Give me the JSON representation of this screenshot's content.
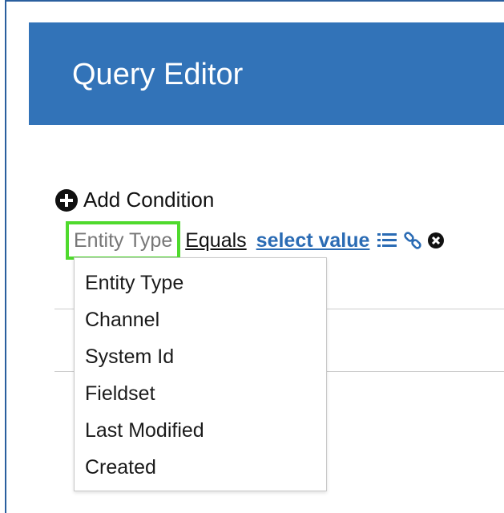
{
  "header": {
    "title": "Query Editor",
    "background_color": "#3273b8"
  },
  "add_condition": {
    "icon": "plus-circle-icon",
    "label": "Add Condition"
  },
  "condition": {
    "field_value": "Entity Type",
    "operator": "Equals",
    "value_placeholder": "select value",
    "icons": [
      "list-icon",
      "link-icon",
      "remove-circle-icon"
    ],
    "highlight_color": "#4fda2d",
    "link_color": "#2a6bb4"
  },
  "dropdown": {
    "items": [
      "Entity Type",
      "Channel",
      "System Id",
      "Fieldset",
      "Last Modified",
      "Created"
    ]
  }
}
